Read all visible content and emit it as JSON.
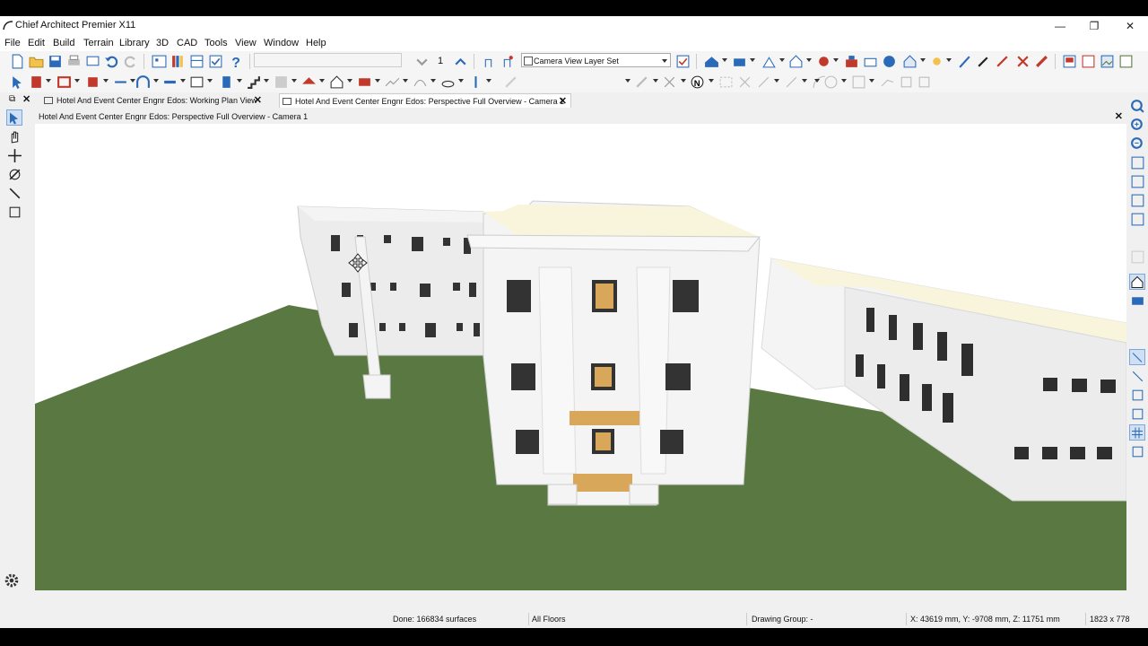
{
  "window": {
    "title": "Chief Architect Premier X11",
    "minimize": "—",
    "restore": "❐",
    "close": "✕"
  },
  "menu": [
    "File",
    "Edit",
    "Build",
    "Terrain",
    "Library",
    "3D",
    "CAD",
    "Tools",
    "View",
    "Window",
    "Help"
  ],
  "toolbar": {
    "layer_set": "Camera View Layer Set",
    "step_value": "1"
  },
  "tabs": [
    {
      "label": "Hotel And Event Center Engnr Edos:  Working Plan View",
      "close": "✕"
    },
    {
      "label": "Hotel And Event Center Engnr Edos: Perspective Full Overview - Camera 1",
      "close": "✕"
    }
  ],
  "view": {
    "header": "Hotel And Event Center Engnr Edos: Perspective Full Overview - Camera 1",
    "close": "✕"
  },
  "status": {
    "done": "Done:  166834 surfaces",
    "floors": "All Floors",
    "drawing_group": "Drawing Group: -",
    "coords": "X: 43619 mm, Y: -9708 mm, Z: 11751 mm",
    "size": "1823 x 778"
  },
  "colors": {
    "grass": "#5a7842",
    "wall": "#f2f2f2",
    "roof": "#f8f5dc",
    "accent_red": "#c0392b",
    "accent_blue": "#2a6ab8"
  }
}
